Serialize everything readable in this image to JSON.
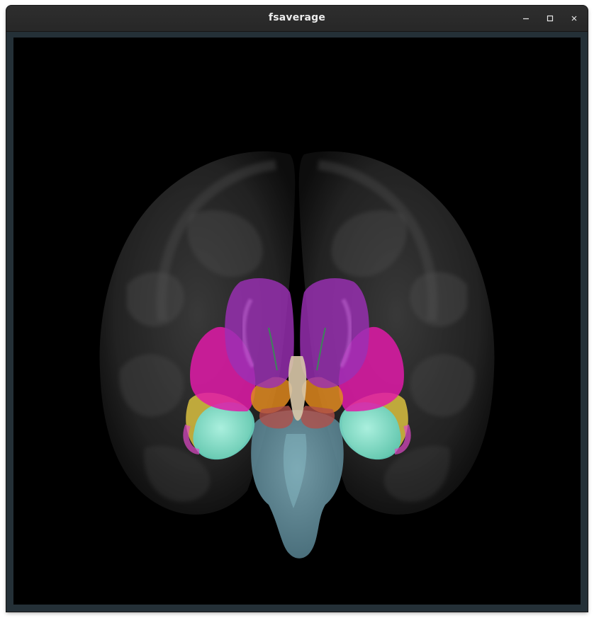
{
  "window": {
    "title": "fsaverage"
  },
  "controls": {
    "minimize_icon": "minimize-icon",
    "maximize_icon": "maximize-icon",
    "close_icon": "close-icon"
  },
  "scene": {
    "background": "#000000",
    "structures": [
      {
        "name": "cortex",
        "color": "#c8c8c8"
      },
      {
        "name": "caudate-putamen",
        "color": "#9b30b5"
      },
      {
        "name": "pallidum-outer",
        "color": "#e01aa8"
      },
      {
        "name": "thalamus",
        "color": "#b86a2a"
      },
      {
        "name": "hippocampus",
        "color": "#7de3cf"
      },
      {
        "name": "amygdala",
        "color": "#d9c040"
      },
      {
        "name": "brainstem",
        "color": "#5f8e9c"
      },
      {
        "name": "ventral-dc",
        "color": "#c0b090"
      }
    ]
  }
}
